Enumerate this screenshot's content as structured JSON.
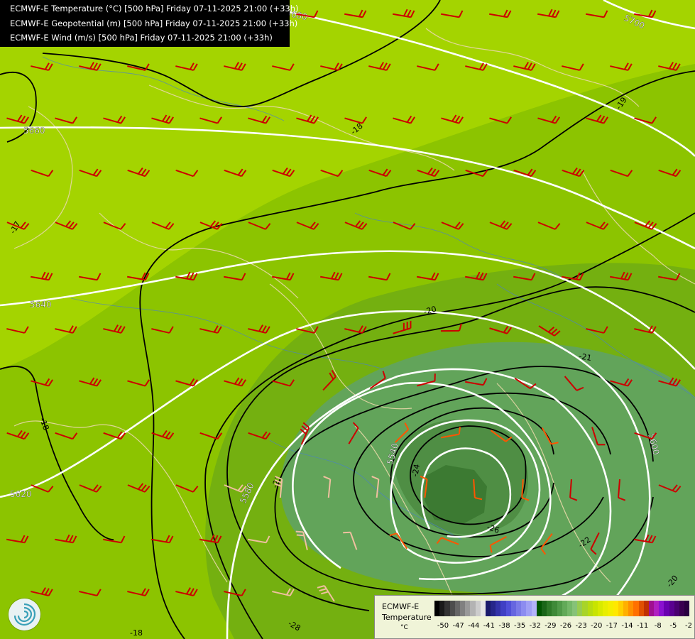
{
  "header": {
    "lines": [
      "ECMWF-E Temperature (°C) [500 hPa] Friday 07-11-2025 21:00 (+33h)",
      "ECMWF-E Geopotential (m) [500 hPa] Friday 07-11-2025 21:00 (+33h)",
      "ECMWF-E Wind (m/s) [500 hPa] Friday 07-11-2025 21:00 (+33h)"
    ]
  },
  "map": {
    "geopotential_labels": [
      "5680",
      "5700",
      "5660",
      "5640",
      "5620",
      "5600",
      "5580",
      "5540"
    ],
    "temperature_labels": [
      "-19",
      "-18",
      "-17",
      "-18",
      "-18",
      "-20",
      "-21",
      "-21",
      "-22",
      "-24",
      "-20",
      "-26",
      "-28",
      "-18"
    ],
    "colors": {
      "temp_bright": "#a4d400",
      "temp_mid": "#8cc400",
      "temp_dark": "#6aa020",
      "cold_core": "#5a9a50",
      "coldest_core": "#3f7d34",
      "contour_line": "#000000",
      "geopotential_line": "#ffffff",
      "wind_barb_strong": "#cc0000",
      "wind_barb_medium": "#ff5500",
      "wind_barb_weak": "#f0c0a0",
      "border_line": "#e8d8a8",
      "river_line": "#4a80c8"
    }
  },
  "legend": {
    "title": "ECMWF-E",
    "subtitle": "Temperature",
    "unit": "°C",
    "ticks": [
      "-50",
      "-47",
      "-44",
      "-41",
      "-38",
      "-35",
      "-32",
      "-29",
      "-26",
      "-23",
      "-20",
      "-17",
      "-14",
      "-11",
      "-8",
      "-5",
      "-2"
    ],
    "colors": [
      "#000000",
      "#1a1a1a",
      "#333333",
      "#4d4d4d",
      "#666666",
      "#808080",
      "#999999",
      "#b3b3b3",
      "#cccccc",
      "#e6e6e6",
      "#1a1a6b",
      "#26268a",
      "#3333a8",
      "#4040c4",
      "#5050d8",
      "#6666e0",
      "#7a7ae8",
      "#8c8cf0",
      "#a0a0f5",
      "#b4b4fa",
      "#005500",
      "#1a6618",
      "#2e7a28",
      "#3f8a38",
      "#509a48",
      "#62aa58",
      "#74b868",
      "#86c278",
      "#98cc50",
      "#a8d428",
      "#b8dc10",
      "#c8e400",
      "#d8ea00",
      "#e8ee00",
      "#f4ee00",
      "#ffe800",
      "#ffd000",
      "#ffb000",
      "#ff9000",
      "#ff7000",
      "#e05000",
      "#c03000",
      "#a01090",
      "#b020c0",
      "#8a10d0",
      "#6a00b0",
      "#5a0090",
      "#4a0070",
      "#3a0050",
      "#2a0040"
    ]
  }
}
